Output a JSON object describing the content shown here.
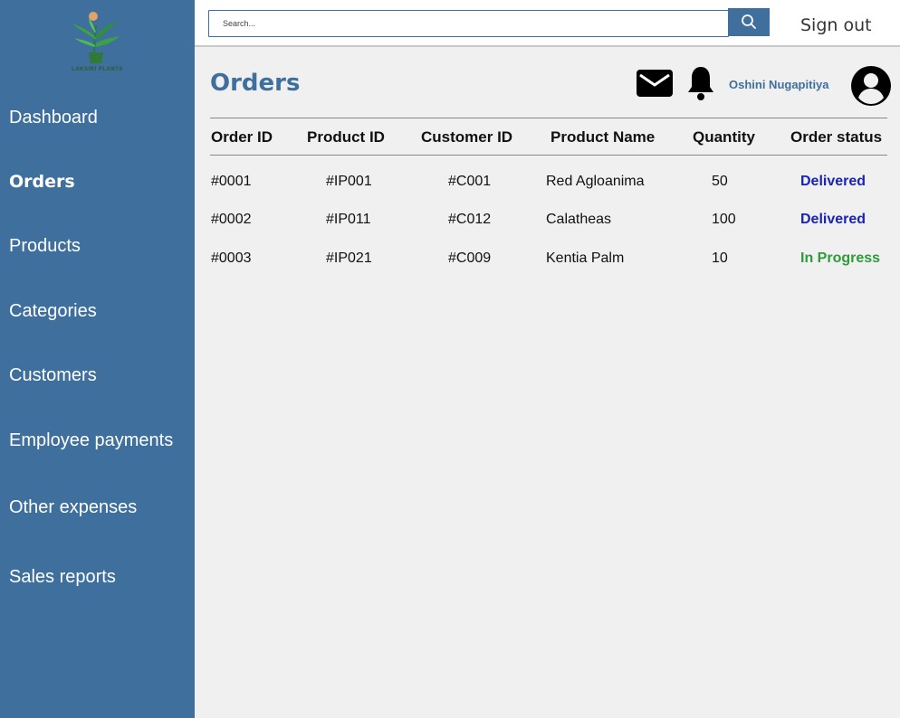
{
  "brand": {
    "name": "LAKSIRI PLANTS",
    "tagline": "...."
  },
  "sidebar": {
    "items": [
      {
        "label": "Dashboard",
        "active": false
      },
      {
        "label": "Orders",
        "active": true
      },
      {
        "label": "Products",
        "active": false
      },
      {
        "label": "Categories",
        "active": false
      },
      {
        "label": "Customers",
        "active": false
      },
      {
        "label": "Employee payments",
        "active": false
      },
      {
        "label": "Other expenses",
        "active": false
      },
      {
        "label": "Sales reports",
        "active": false
      }
    ]
  },
  "topbar": {
    "search_placeholder": "Search...",
    "search_icon": "search-icon",
    "signout_label": "Sign out"
  },
  "header": {
    "title": "Orders",
    "icons": [
      "mail-icon",
      "bell-icon",
      "user-avatar-icon"
    ],
    "user_name": "Oshini Nugapitiya"
  },
  "orders_table": {
    "columns": [
      "Order ID",
      "Product ID",
      "Customer ID",
      "Product Name",
      "Quantity",
      "Order status"
    ],
    "rows": [
      {
        "order_id": "#0001",
        "product_id": "#IP001",
        "customer_id": "#C001",
        "product_name": "Red Agloanima",
        "quantity": "50",
        "status": "Delivered",
        "status_color": "#1a22b8"
      },
      {
        "order_id": "#0002",
        "product_id": "#IP011",
        "customer_id": "#C012",
        "product_name": "Calatheas",
        "quantity": "100",
        "status": "Delivered",
        "status_color": "#1a22b8"
      },
      {
        "order_id": "#0003",
        "product_id": "#IP021",
        "customer_id": "#C009",
        "product_name": "Kentia Palm",
        "quantity": "10",
        "status": "In Progress",
        "status_color": "#2e9a3a"
      }
    ]
  },
  "colors": {
    "primary": "#3f6f9c",
    "background": "#f0f0f0",
    "delivered": "#1a22b8",
    "in_progress": "#2e9a3a"
  }
}
